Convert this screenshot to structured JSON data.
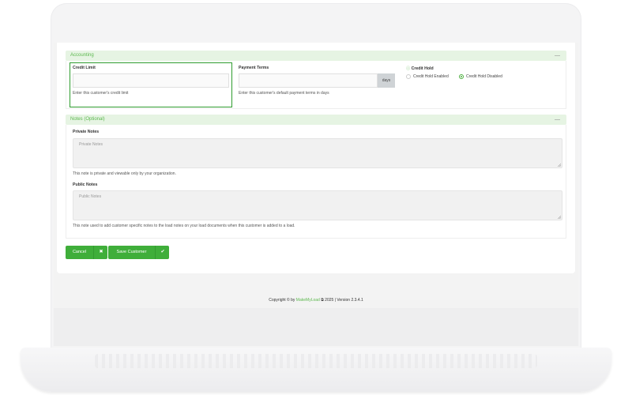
{
  "accounting": {
    "section_title": "Accounting",
    "collapse_symbol": "—",
    "credit_limit": {
      "label": "Credit Limit",
      "value": "",
      "help": "Enter this customer's credit limit"
    },
    "payment_terms": {
      "label": "Payment Terms",
      "value": "",
      "addon": "days",
      "help": "Enter this customer's default payment terms in days"
    },
    "credit_hold": {
      "label": "Credit Hold",
      "options": [
        "Credit Hold Enabled",
        "Credit Hold Disabled"
      ],
      "selected": "Credit Hold Disabled"
    }
  },
  "notes": {
    "section_title": "Notes (Optional)",
    "collapse_symbol": "—",
    "private": {
      "label": "Private Notes",
      "placeholder": "Private Notes",
      "help": "This note is private and viewable only by your organization."
    },
    "public": {
      "label": "Public Notes",
      "placeholder": "Public Notes",
      "help": "This note used to add customer specific notes to the load notes on your load documents when this customer is added to a load."
    }
  },
  "actions": {
    "cancel_label": "Cancel",
    "cancel_icon": "✖",
    "save_label": "Save Customer",
    "save_icon": "✔"
  },
  "footer": {
    "copyright_prefix": "Copyright © by",
    "brand": "MakeMyLoad",
    "external_icon": "⧉",
    "suffix": "2025 | Version 2.3.4.1"
  },
  "colors": {
    "accent": "#3fae3a",
    "section_header_bg": "#e6f4e3",
    "focus_border": "#2e9c2e"
  }
}
